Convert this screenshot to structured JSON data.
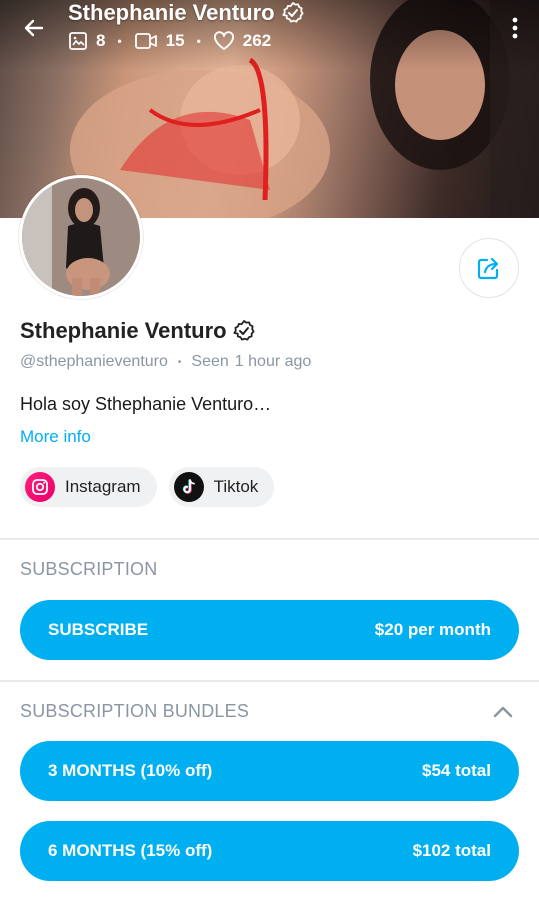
{
  "header": {
    "title": "Sthephanie Venturo",
    "stats": {
      "photos": "8",
      "videos": "15",
      "likes": "262"
    }
  },
  "profile": {
    "name": "Sthephanie Venturo",
    "handle": "@sthephanieventuro",
    "seen_label": "Seen",
    "seen_time": "1 hour ago",
    "bio": "Hola soy Sthephanie Venturo…",
    "more_info": "More info",
    "socials": [
      {
        "label": "Instagram",
        "icon": "instagram-icon"
      },
      {
        "label": "Tiktok",
        "icon": "tiktok-icon"
      }
    ]
  },
  "subscription": {
    "title": "SUBSCRIPTION",
    "button_label": "SUBSCRIBE",
    "button_price": "$20 per month"
  },
  "bundles": {
    "title": "SUBSCRIPTION BUNDLES",
    "items": [
      {
        "label": "3 MONTHS (10% off)",
        "price": "$54 total"
      },
      {
        "label": "6 MONTHS (15% off)",
        "price": "$102 total"
      }
    ]
  },
  "colors": {
    "accent": "#00aff0",
    "muted": "#8a96a3",
    "instagram": "#f01f78",
    "tiktok": "#111111"
  },
  "icons": [
    "back-arrow-icon",
    "more-vertical-icon",
    "verified-icon",
    "image-icon",
    "video-icon",
    "heart-icon",
    "share-icon",
    "chevron-up-icon"
  ]
}
